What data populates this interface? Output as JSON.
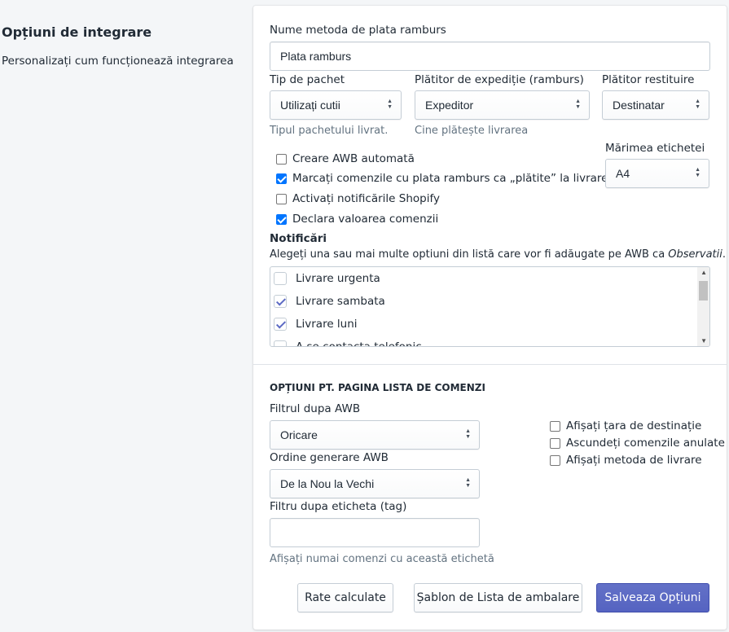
{
  "sidebar": {
    "title": "Opțiuni de integrare",
    "description": "Personalizați cum funcționează integrarea"
  },
  "cod_method": {
    "label": "Nume metoda de plata ramburs",
    "value": "Plata ramburs"
  },
  "package_type": {
    "label": "Tip de pachet",
    "value": "Utilizați cutii",
    "help": "Tipul pachetului livrat."
  },
  "shipping_payer": {
    "label": "Plătitor de expediție (ramburs)",
    "value": "Expeditor",
    "help": "Cine plătește livrarea"
  },
  "return_payer": {
    "label": "Plătitor restituire",
    "value": "Destinatar"
  },
  "label_size": {
    "label": "Mărimea etichetei",
    "value": "A4"
  },
  "options": [
    {
      "label": "Creare AWB automată",
      "checked": false
    },
    {
      "label": "Marcați comenzile cu plata ramburs ca „plătite” la livrare",
      "checked": true
    },
    {
      "label": "Activați notificările Shopify",
      "checked": false
    },
    {
      "label": "Declara valoarea comenzii",
      "checked": true
    }
  ],
  "notifications": {
    "title": "Notificări",
    "description_prefix": "Alegeți una sau mai multe optiuni din listă care vor fi adăugate pe AWB ca ",
    "description_em": "Observatii",
    "description_suffix": ".",
    "items": [
      {
        "label": "Livrare urgenta",
        "checked": false
      },
      {
        "label": "Livrare sambata",
        "checked": true
      },
      {
        "label": "Livrare luni",
        "checked": true
      },
      {
        "label": "A se contacta telefonic",
        "checked": false
      }
    ]
  },
  "orders_section": {
    "title": "OPȚIUNI PT. PAGINA LISTA DE COMENZI",
    "awb_filter": {
      "label": "Filtrul dupa AWB",
      "value": "Oricare"
    },
    "awb_order": {
      "label": "Ordine generare AWB",
      "value": "De la Nou la Vechi"
    },
    "tag_filter": {
      "label": "Filtru dupa eticheta (tag)",
      "value": "",
      "help": "Afișați numai comenzi cu această etichetă"
    },
    "checkboxes": [
      {
        "label": "Afișați țara de destinație",
        "checked": false
      },
      {
        "label": "Ascundeți comenzile anulate",
        "checked": false
      },
      {
        "label": "Afișați metoda de livrare",
        "checked": false
      }
    ]
  },
  "buttons": {
    "rates": "Rate calculate",
    "packing_template": "Șablon de Lista de ambalare",
    "save": "Salveaza Opțiuni"
  }
}
